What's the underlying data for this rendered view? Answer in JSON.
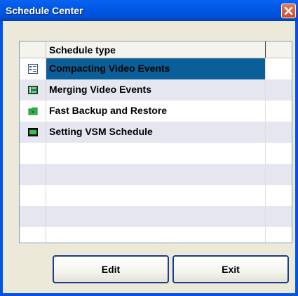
{
  "window": {
    "title": "Schedule Center"
  },
  "grid": {
    "column_header": "Schedule type",
    "rows": [
      {
        "label": "Compacting Video Events",
        "icon": "compact-events-icon",
        "selected": true
      },
      {
        "label": "Merging Video Events",
        "icon": "merge-events-icon",
        "selected": false
      },
      {
        "label": "Fast Backup and Restore",
        "icon": "backup-restore-icon",
        "selected": false
      },
      {
        "label": "Setting VSM Schedule",
        "icon": "vsm-schedule-icon",
        "selected": false
      }
    ]
  },
  "buttons": {
    "edit": "Edit",
    "exit": "Exit"
  },
  "colors": {
    "titlebar": "#0058e6",
    "selection": "#0b5f99",
    "alt_row": "#e6e6f0"
  }
}
